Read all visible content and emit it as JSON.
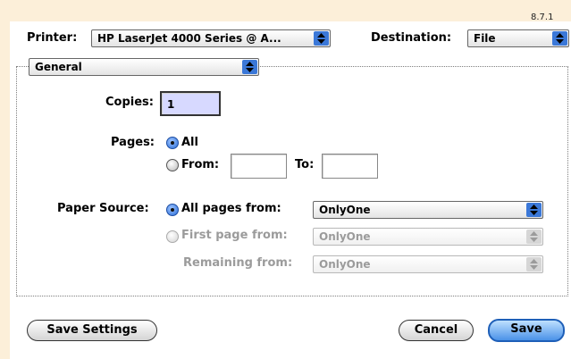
{
  "version": "8.7.1",
  "printer": {
    "label": "Printer:",
    "value": "HP LaserJet 4000 Series @ A..."
  },
  "destination": {
    "label": "Destination:",
    "value": "File"
  },
  "section": {
    "value": "General"
  },
  "copies": {
    "label": "Copies:",
    "value": "1"
  },
  "pages": {
    "label": "Pages:",
    "all_label": "All",
    "from_label": "From:",
    "to_label": "To:",
    "from_value": "",
    "to_value": ""
  },
  "paper_source": {
    "label": "Paper Source:",
    "all_pages_label": "All pages from:",
    "all_pages_value": "OnlyOne",
    "first_page_label": "First page from:",
    "first_page_value": "OnlyOne",
    "remaining_label": "Remaining from:",
    "remaining_value": "OnlyOne"
  },
  "buttons": {
    "save_settings": "Save Settings",
    "cancel": "Cancel",
    "save": "Save"
  },
  "colors": {
    "background": "#fcefd9",
    "accent": "#3b78d8"
  }
}
